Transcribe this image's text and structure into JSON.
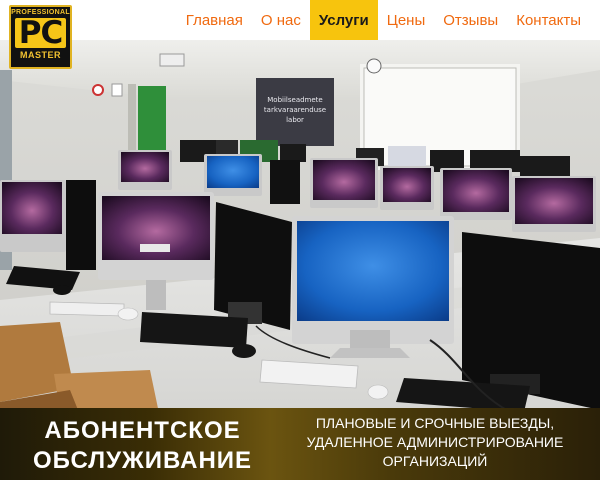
{
  "logo": {
    "top": "PROFESSIONAL",
    "middle": "PC",
    "bottom": "MASTER"
  },
  "nav": {
    "items": [
      {
        "label": "Главная",
        "active": false
      },
      {
        "label": "О нас",
        "active": false
      },
      {
        "label": "Услуги",
        "active": true
      },
      {
        "label": "Цены",
        "active": false
      },
      {
        "label": "Отзывы",
        "active": false
      },
      {
        "label": "Контакты",
        "active": false
      }
    ]
  },
  "hero": {
    "whiteboard_text": [
      "Mobiilseadmete",
      "tarkvaraarenduse",
      "labor"
    ]
  },
  "banner": {
    "title_line1": "АБОНЕНТСКОЕ",
    "title_line2": "ОБСЛУЖИВАНИЕ",
    "subtitle_line1": "ПЛАНОВЫЕ И СРОЧНЫЕ ВЫЕЗДЫ,",
    "subtitle_line2": "УДАЛЕННОЕ АДМИНИСТРИРОВАНИЕ",
    "subtitle_line3": "ОРГАНИЗАЦИЙ"
  },
  "colors": {
    "nav_text": "#f06a10",
    "nav_active_bg": "#f7c40d",
    "logo_yellow": "#f5c518"
  }
}
